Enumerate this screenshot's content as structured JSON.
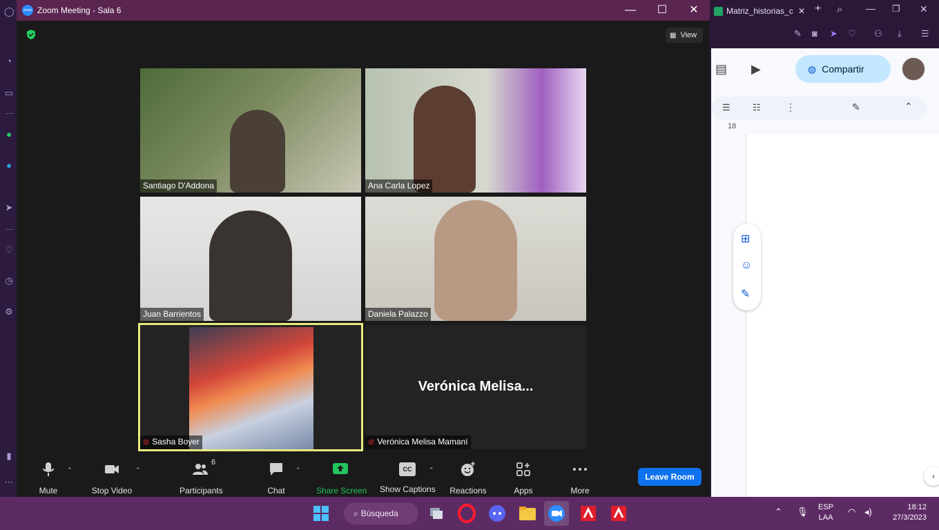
{
  "zoom": {
    "window_title": "Zoom Meeting - Sala 6",
    "logo_text": "zoom",
    "view_label": "View",
    "participants": [
      {
        "name": "Santiago D'Addona",
        "muted": false
      },
      {
        "name": "Ana Carla Lopez",
        "muted": false
      },
      {
        "name": "Juan Barrientos",
        "muted": false
      },
      {
        "name": "Daniela Palazzo",
        "muted": false
      },
      {
        "name": "Sasha Boyer",
        "muted": true
      },
      {
        "name": "Verónica Melisa Mamaní",
        "muted": true,
        "display_big": "Verónica  Melisa..."
      }
    ],
    "toolbar": {
      "mute": "Mute",
      "stop_video": "Stop Video",
      "participants": "Participants",
      "participants_count": "6",
      "chat": "Chat",
      "share_screen": "Share Screen",
      "show_captions": "Show Captions",
      "captions_icon": "CC",
      "reactions": "Reactions",
      "apps": "Apps",
      "more": "More",
      "leave": "Leave Room"
    }
  },
  "browser": {
    "tab_title": "Matriz_historias_c",
    "doc": {
      "share_button": "Compartir",
      "ruler_mark": "18"
    }
  },
  "taskbar": {
    "search_label": "Búsqueda",
    "language_line1": "ESP",
    "language_line2": "LAA",
    "time": "18:12",
    "date": "27/3/2023"
  },
  "colors": {
    "zoom_title_bar": "#5a2550",
    "active_speaker_border": "#e8ea7d",
    "share_screen_green": "#22c55e",
    "leave_button": "#0e72ed",
    "taskbar": "#5d2b64"
  }
}
